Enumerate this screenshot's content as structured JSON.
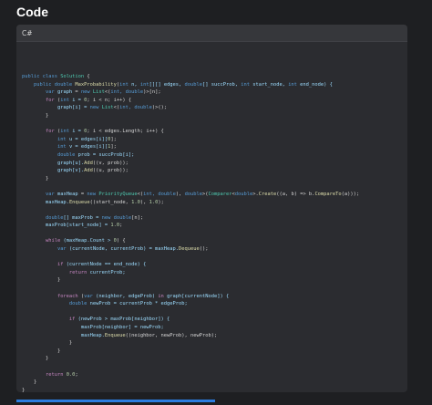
{
  "page": {
    "title": "Code"
  },
  "code_block": {
    "language": "C#",
    "lines": [
      [
        {
          "t": "public class ",
          "c": "kw"
        },
        {
          "t": "Solution",
          "c": "ty"
        },
        {
          "t": " {",
          "c": "pl"
        }
      ],
      [
        {
          "t": "    public double ",
          "c": "kw"
        },
        {
          "t": "MaxProbability",
          "c": "fn"
        },
        {
          "t": "(",
          "c": "pl"
        },
        {
          "t": "int",
          "c": "kw"
        },
        {
          "t": " n, ",
          "c": "pr"
        },
        {
          "t": "int",
          "c": "kw"
        },
        {
          "t": "[][] edges, ",
          "c": "pr"
        },
        {
          "t": "double",
          "c": "kw"
        },
        {
          "t": "[] succProb, ",
          "c": "pr"
        },
        {
          "t": "int",
          "c": "kw"
        },
        {
          "t": " start_node, ",
          "c": "pr"
        },
        {
          "t": "int",
          "c": "kw"
        },
        {
          "t": " end_node) {",
          "c": "pr"
        }
      ],
      [
        {
          "t": "        var ",
          "c": "kw"
        },
        {
          "t": "graph",
          "c": "pr"
        },
        {
          "t": " = ",
          "c": "pl"
        },
        {
          "t": "new ",
          "c": "kw"
        },
        {
          "t": "List",
          "c": "ty"
        },
        {
          "t": "<(",
          "c": "pl"
        },
        {
          "t": "int, double",
          "c": "kw"
        },
        {
          "t": ")>[n];",
          "c": "pl"
        }
      ],
      [
        {
          "t": "        for ",
          "c": "ct"
        },
        {
          "t": "(",
          "c": "pl"
        },
        {
          "t": "int ",
          "c": "kw"
        },
        {
          "t": "i = ",
          "c": "pr"
        },
        {
          "t": "0",
          "c": "nu"
        },
        {
          "t": "; i < n; i++) {",
          "c": "pl"
        }
      ],
      [
        {
          "t": "            graph[i] = ",
          "c": "pr"
        },
        {
          "t": "new ",
          "c": "kw"
        },
        {
          "t": "List",
          "c": "ty"
        },
        {
          "t": "<(",
          "c": "pl"
        },
        {
          "t": "int, double",
          "c": "kw"
        },
        {
          "t": ")>();",
          "c": "pl"
        }
      ],
      [
        {
          "t": "        }",
          "c": "pl"
        }
      ],
      [
        {
          "t": "",
          "c": "pl"
        }
      ],
      [
        {
          "t": "        for ",
          "c": "ct"
        },
        {
          "t": "(",
          "c": "pl"
        },
        {
          "t": "int ",
          "c": "kw"
        },
        {
          "t": "i = ",
          "c": "pr"
        },
        {
          "t": "0",
          "c": "nu"
        },
        {
          "t": "; i < edges.Length; i++) {",
          "c": "pl"
        }
      ],
      [
        {
          "t": "            int ",
          "c": "kw"
        },
        {
          "t": "u = edges[i][",
          "c": "pr"
        },
        {
          "t": "0",
          "c": "nu"
        },
        {
          "t": "];",
          "c": "pl"
        }
      ],
      [
        {
          "t": "            int ",
          "c": "kw"
        },
        {
          "t": "v = edges[i][",
          "c": "pr"
        },
        {
          "t": "1",
          "c": "nu"
        },
        {
          "t": "];",
          "c": "pl"
        }
      ],
      [
        {
          "t": "            double ",
          "c": "kw"
        },
        {
          "t": "prob = succProb[i];",
          "c": "pr"
        }
      ],
      [
        {
          "t": "            graph[u].",
          "c": "pr"
        },
        {
          "t": "Add",
          "c": "fn"
        },
        {
          "t": "((v, prob));",
          "c": "pl"
        }
      ],
      [
        {
          "t": "            graph[v].",
          "c": "pr"
        },
        {
          "t": "Add",
          "c": "fn"
        },
        {
          "t": "((u, prob));",
          "c": "pl"
        }
      ],
      [
        {
          "t": "        }",
          "c": "pl"
        }
      ],
      [
        {
          "t": "",
          "c": "pl"
        }
      ],
      [
        {
          "t": "        var ",
          "c": "kw"
        },
        {
          "t": "maxHeap",
          "c": "pr"
        },
        {
          "t": " = ",
          "c": "pl"
        },
        {
          "t": "new ",
          "c": "kw"
        },
        {
          "t": "PriorityQueue",
          "c": "ty"
        },
        {
          "t": "<(",
          "c": "pl"
        },
        {
          "t": "int, double",
          "c": "kw"
        },
        {
          "t": "), ",
          "c": "pl"
        },
        {
          "t": "double",
          "c": "kw"
        },
        {
          "t": ">(",
          "c": "pl"
        },
        {
          "t": "Comparer",
          "c": "ty"
        },
        {
          "t": "<",
          "c": "pl"
        },
        {
          "t": "double",
          "c": "kw"
        },
        {
          "t": ">.",
          "c": "pl"
        },
        {
          "t": "Create",
          "c": "fn"
        },
        {
          "t": "((a, b) => b.",
          "c": "pl"
        },
        {
          "t": "CompareTo",
          "c": "fn"
        },
        {
          "t": "(a)));",
          "c": "pl"
        }
      ],
      [
        {
          "t": "        maxHeap.",
          "c": "pr"
        },
        {
          "t": "Enqueue",
          "c": "fn"
        },
        {
          "t": "((start_node, ",
          "c": "pl"
        },
        {
          "t": "1.0",
          "c": "nu"
        },
        {
          "t": "), ",
          "c": "pl"
        },
        {
          "t": "1.0",
          "c": "nu"
        },
        {
          "t": ");",
          "c": "pl"
        }
      ],
      [
        {
          "t": "",
          "c": "pl"
        }
      ],
      [
        {
          "t": "        double",
          "c": "kw"
        },
        {
          "t": "[] maxProb = ",
          "c": "pr"
        },
        {
          "t": "new ",
          "c": "kw"
        },
        {
          "t": "double",
          "c": "kw"
        },
        {
          "t": "[n];",
          "c": "pl"
        }
      ],
      [
        {
          "t": "        maxProb[start_node] = ",
          "c": "pr"
        },
        {
          "t": "1.0",
          "c": "nu"
        },
        {
          "t": ";",
          "c": "pl"
        }
      ],
      [
        {
          "t": "",
          "c": "pl"
        }
      ],
      [
        {
          "t": "        while ",
          "c": "ct"
        },
        {
          "t": "(maxHeap.Count > ",
          "c": "pr"
        },
        {
          "t": "0",
          "c": "nu"
        },
        {
          "t": ") {",
          "c": "pl"
        }
      ],
      [
        {
          "t": "            var ",
          "c": "kw"
        },
        {
          "t": "(currentNode, currentProb) = maxHeap.",
          "c": "pr"
        },
        {
          "t": "Dequeue",
          "c": "fn"
        },
        {
          "t": "();",
          "c": "pl"
        }
      ],
      [
        {
          "t": "",
          "c": "pl"
        }
      ],
      [
        {
          "t": "            if ",
          "c": "ct"
        },
        {
          "t": "(currentNode == end_node) {",
          "c": "pr"
        }
      ],
      [
        {
          "t": "                return ",
          "c": "ct"
        },
        {
          "t": "currentProb;",
          "c": "pr"
        }
      ],
      [
        {
          "t": "            }",
          "c": "pl"
        }
      ],
      [
        {
          "t": "",
          "c": "pl"
        }
      ],
      [
        {
          "t": "            foreach ",
          "c": "ct"
        },
        {
          "t": "(",
          "c": "pl"
        },
        {
          "t": "var ",
          "c": "kw"
        },
        {
          "t": "(neighbor, edgeProb) ",
          "c": "pr"
        },
        {
          "t": "in ",
          "c": "ct"
        },
        {
          "t": "graph[currentNode]) {",
          "c": "pr"
        }
      ],
      [
        {
          "t": "                double ",
          "c": "kw"
        },
        {
          "t": "newProb = currentProb * edgeProb;",
          "c": "pr"
        }
      ],
      [
        {
          "t": "",
          "c": "pl"
        }
      ],
      [
        {
          "t": "                if ",
          "c": "ct"
        },
        {
          "t": "(newProb > maxProb[neighbor]) {",
          "c": "pr"
        }
      ],
      [
        {
          "t": "                    maxProb[neighbor] = newProb;",
          "c": "pr"
        }
      ],
      [
        {
          "t": "                    maxHeap.",
          "c": "pr"
        },
        {
          "t": "Enqueue",
          "c": "fn"
        },
        {
          "t": "((neighbor, newProb), newProb);",
          "c": "pl"
        }
      ],
      [
        {
          "t": "                }",
          "c": "pl"
        }
      ],
      [
        {
          "t": "            }",
          "c": "pl"
        }
      ],
      [
        {
          "t": "        }",
          "c": "pl"
        }
      ],
      [
        {
          "t": "",
          "c": "pl"
        }
      ],
      [
        {
          "t": "        return ",
          "c": "ct"
        },
        {
          "t": "0.0",
          "c": "nu"
        },
        {
          "t": ";",
          "c": "pl"
        }
      ],
      [
        {
          "t": "    }",
          "c": "pl"
        }
      ],
      [
        {
          "t": "}",
          "c": "pl"
        }
      ]
    ]
  },
  "colors": {
    "background": "#1e1f22",
    "card": "#2b2c30",
    "keyword": "#569cd6",
    "type": "#4ec9b0",
    "function": "#dcdcaa",
    "identifier": "#9cdcfe",
    "number": "#b5cea8",
    "control": "#c586c0",
    "accent_bar": "#2b7de0"
  }
}
